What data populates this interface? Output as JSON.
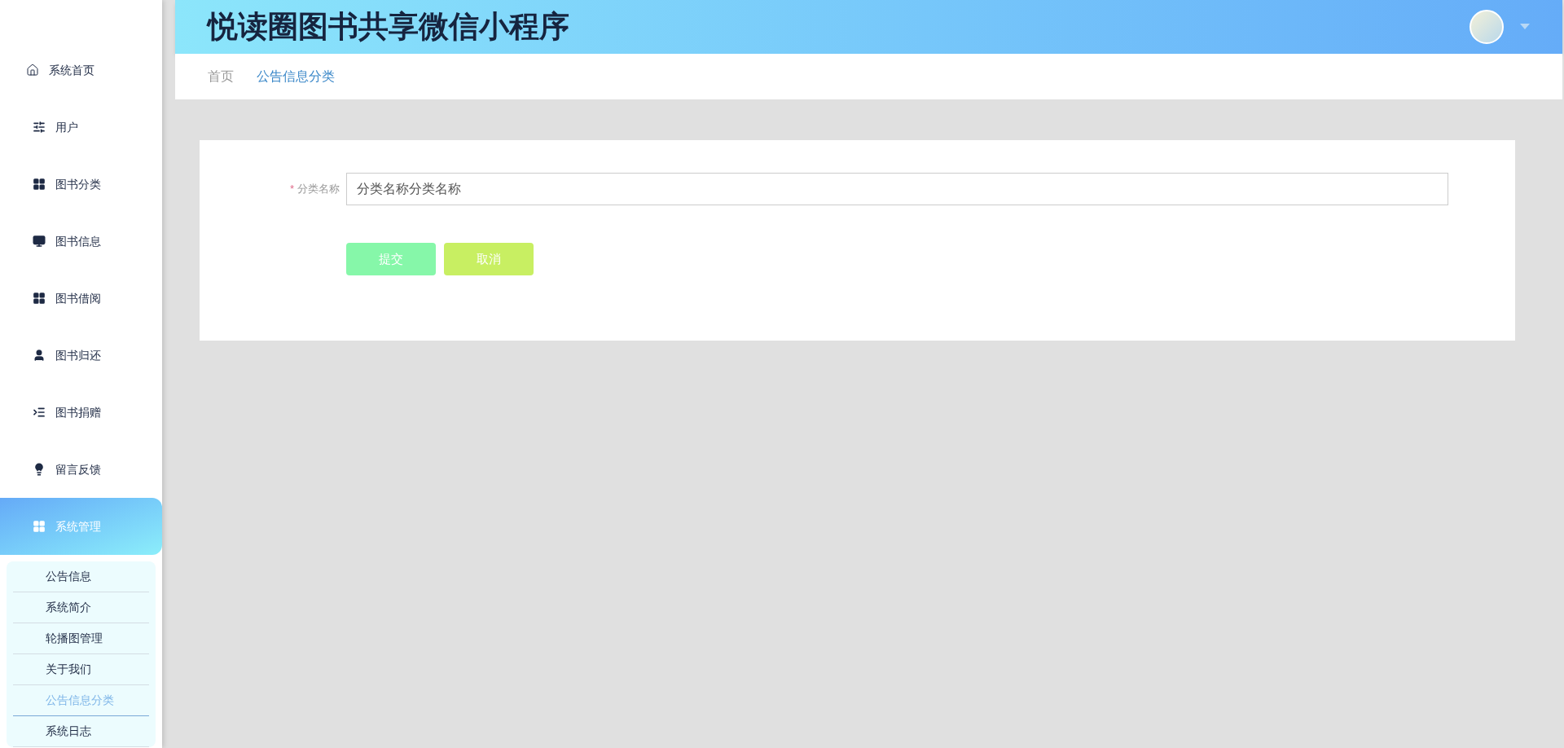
{
  "header": {
    "title": "悦读圈图书共享微信小程序"
  },
  "sidebar": {
    "items": [
      {
        "label": "系统首页",
        "selected": false
      },
      {
        "label": "用户",
        "selected": false
      },
      {
        "label": "图书分类",
        "selected": false
      },
      {
        "label": "图书信息",
        "selected": false
      },
      {
        "label": "图书借阅",
        "selected": false
      },
      {
        "label": "图书归还",
        "selected": false
      },
      {
        "label": "图书捐赠",
        "selected": false
      },
      {
        "label": "留言反馈",
        "selected": false
      },
      {
        "label": "系统管理",
        "selected": true,
        "expanded": true,
        "children": [
          {
            "label": "公告信息",
            "selected": false
          },
          {
            "label": "系统简介",
            "selected": false
          },
          {
            "label": "轮播图管理",
            "selected": false
          },
          {
            "label": "关于我们",
            "selected": false
          },
          {
            "label": "公告信息分类",
            "selected": true
          },
          {
            "label": "系统日志",
            "selected": false
          }
        ]
      }
    ]
  },
  "breadcrumb": [
    "首页",
    "公告信息分类"
  ],
  "form": {
    "fields": [
      {
        "label": "分类名称",
        "required": true,
        "required_mark": "*",
        "value": "分类名称分类名称"
      }
    ],
    "buttons": [
      {
        "label": "提交",
        "color": "#86f7a9"
      },
      {
        "label": "取消",
        "color": "#c8ef62"
      }
    ]
  }
}
